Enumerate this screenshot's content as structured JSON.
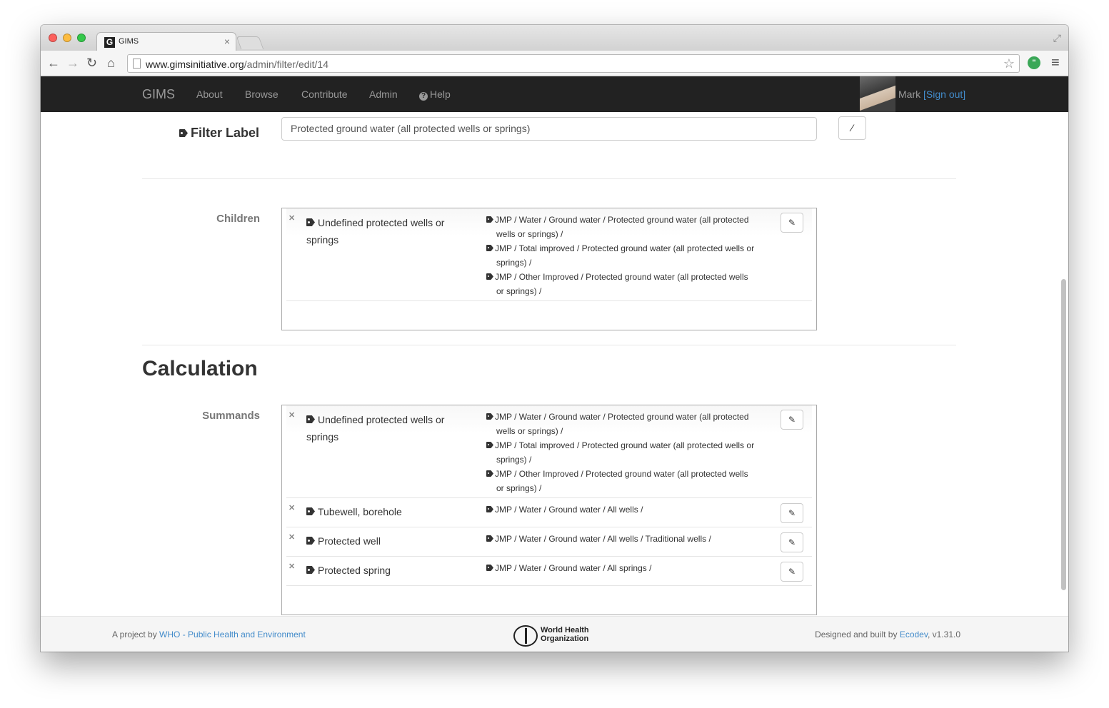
{
  "browser": {
    "tab_title": "GIMS",
    "tab_favicon": "G",
    "url_host": "www.gimsinitiative.org",
    "url_path": "/admin/filter/edit/14"
  },
  "navbar": {
    "brand": "GIMS",
    "links": [
      "About",
      "Browse",
      "Contribute",
      "Admin",
      "Help"
    ],
    "user_name": "Mark",
    "signout_label": "[Sign out]"
  },
  "filter_label": {
    "label": "Filter Label",
    "value": "Protected ground water (all protected wells or springs)"
  },
  "children": {
    "label": "Children",
    "items": [
      {
        "name": "Undefined protected wells or springs",
        "paths": [
          "JMP / Water / Ground water / Protected ground water (all protected wells or springs) /",
          "JMP / Total improved / Protected ground water (all protected wells or springs) /",
          "JMP / Other Improved / Protected ground water (all protected wells or springs) /"
        ]
      }
    ]
  },
  "calculation": {
    "heading": "Calculation",
    "summands_label": "Summands",
    "items": [
      {
        "name": "Undefined protected wells or springs",
        "paths": [
          "JMP / Water / Ground water / Protected ground water (all protected wells or springs) /",
          "JMP / Total improved / Protected ground water (all protected wells or springs) /",
          "JMP / Other Improved / Protected ground water (all protected wells or springs) /"
        ]
      },
      {
        "name": "Tubewell, borehole",
        "paths": [
          "JMP / Water / Ground water / All wells /"
        ]
      },
      {
        "name": "Protected well",
        "paths": [
          "JMP / Water / Ground water / All wells / Traditional wells /"
        ]
      },
      {
        "name": "Protected spring",
        "paths": [
          "JMP / Water / Ground water / All springs /"
        ]
      }
    ]
  },
  "footer": {
    "left_prefix": "A project by",
    "left_link": "WHO - Public Health and Environment",
    "who_line1": "World Health",
    "who_line2": "Organization",
    "right_prefix": "Designed and built by",
    "right_link": "Ecodev",
    "version": ", v1.31.0"
  },
  "icons": {
    "remove": "×",
    "edit": "✎",
    "wand": "⁄"
  },
  "colors": {
    "navbar_bg": "#222222",
    "link": "#428bca"
  }
}
